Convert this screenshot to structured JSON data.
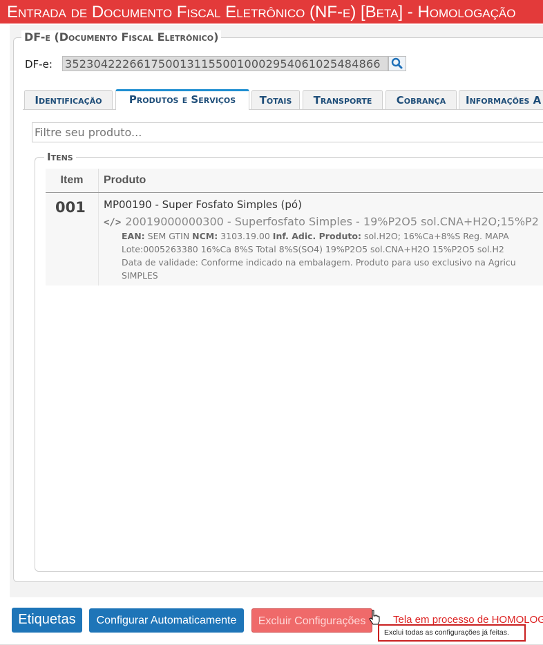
{
  "window": {
    "title": "Entrada de Documento Fiscal Eletrônico (NF-e) [Beta]  - Homologação"
  },
  "dfe": {
    "legend": "DF-e (Documento Fiscal Eletrônico)",
    "label": "DF-e:",
    "value": "35230422266175001311550010002954061025484866",
    "search_icon": "search-icon"
  },
  "tabs": [
    {
      "label": "Identificação",
      "active": false
    },
    {
      "label": "Produtos e Serviços",
      "active": true
    },
    {
      "label": "Totais",
      "active": false
    },
    {
      "label": "Transporte",
      "active": false
    },
    {
      "label": "Cobrança",
      "active": false
    },
    {
      "label": "Informações A",
      "active": false
    }
  ],
  "filter": {
    "placeholder": "Filtre seu produto..."
  },
  "itens": {
    "legend": "Itens",
    "columns": [
      "Item",
      "Produto"
    ],
    "rows": [
      {
        "item": "001",
        "produto": "MP00190 - Super Fosfato Simples (pó)",
        "fornecedor_produto": "20019000000300 - Superfosfato Simples - 19%P2O5 sol.CNA+H2O;15%P2",
        "ean_label": "EAN:",
        "ean": "SEM GTIN",
        "ncm_label": "NCM:",
        "ncm": "3103.19.00",
        "inf_label": "Inf. Adic. Produto:",
        "inf_1": "sol.H2O; 16%Ca+8%S Reg. MAPA",
        "inf_2": "Lote:0005263380 16%Ca 8%S Total 8%S(SO4) 19%P2O5 sol.CNA+H2O 15%P2O5 sol.H2",
        "inf_3": "Data de validade: Conforme indicado na embalagem. Produto para uso exclusivo na Agricu",
        "inf_4": "SIMPLES"
      }
    ]
  },
  "footer": {
    "etiquetas_label": "Etiquetas",
    "auto_label": "Configurar Automaticamente",
    "excluir_label": "Excluir Configurações",
    "status": "Tela em processo de HOMOLOGA",
    "tooltip": "Exclui todas as configurações já feitas."
  },
  "colors": {
    "title_bar": "#e33a3a",
    "primary_button": "#1e75b8",
    "danger_button": "#ef6a6a",
    "active_tab_border": "#1f8fd1"
  }
}
